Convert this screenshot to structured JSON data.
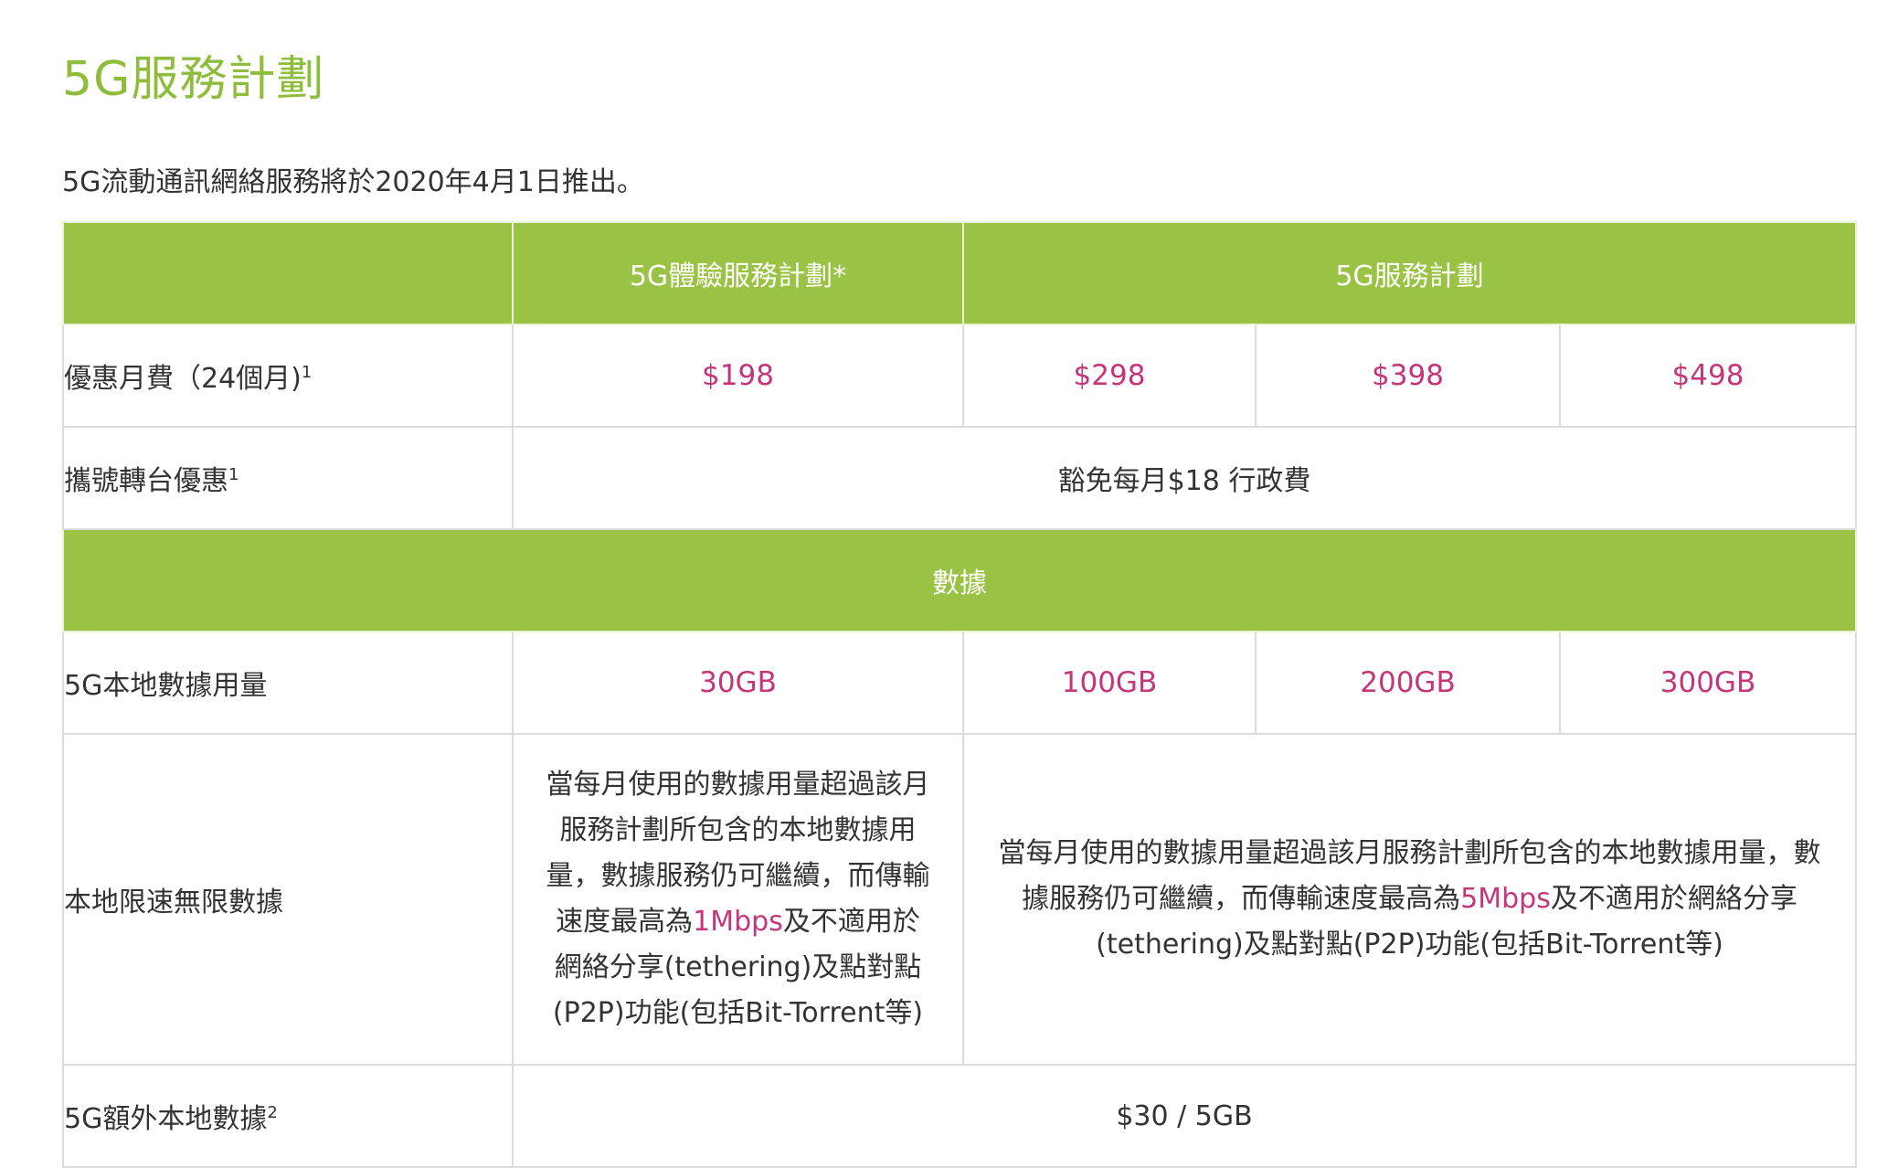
{
  "page": {
    "title": "5G服務計劃",
    "intro": "5G流動通訊網絡服務將於2020年4月1日推出。"
  },
  "table": {
    "header": {
      "plan_a": "5G體驗服務計劃*",
      "plan_b": "5G服務計劃"
    },
    "monthly_fee": {
      "label": "優惠月費（24個月)",
      "note": "1",
      "prices": [
        "$198",
        "$298",
        "$398",
        "$498"
      ]
    },
    "port_in": {
      "label": "攜號轉台優惠",
      "note": "1",
      "value": "豁免每月$18 行政費"
    },
    "section_data": "數據",
    "local_data": {
      "label": "5G本地數據用量",
      "amounts": [
        "30GB",
        "100GB",
        "200GB",
        "300GB"
      ]
    },
    "unlimited": {
      "label": "本地限速無限數據",
      "plan_a": {
        "before": "當每月使用的數據用量超過該月服務計劃所包含的本地數據用量，數據服務仍可繼續，而傳輸速度最高為",
        "speed": "1Mbps",
        "after": "及不適用於網絡分享(tethering)及點對點(P2P)功能(包括Bit-Torrent等)"
      },
      "plan_b": {
        "before": "當每月使用的數據用量超過該月服務計劃所包含的本地數據用量，數據服務仍可繼續，而傳輸速度最高為",
        "speed": "5Mbps",
        "after": "及不適用於網絡分享(tethering)及點對點(P2P)功能(包括Bit-Torrent等)"
      }
    },
    "extra_data": {
      "label": "5G額外本地數據",
      "note": "2",
      "value": "$30 / 5GB"
    }
  },
  "colors": {
    "brand_green": "#9ac244",
    "title_green": "#8dbd3b",
    "accent_magenta": "#c4357a",
    "border_gray": "#dcdcdc"
  }
}
